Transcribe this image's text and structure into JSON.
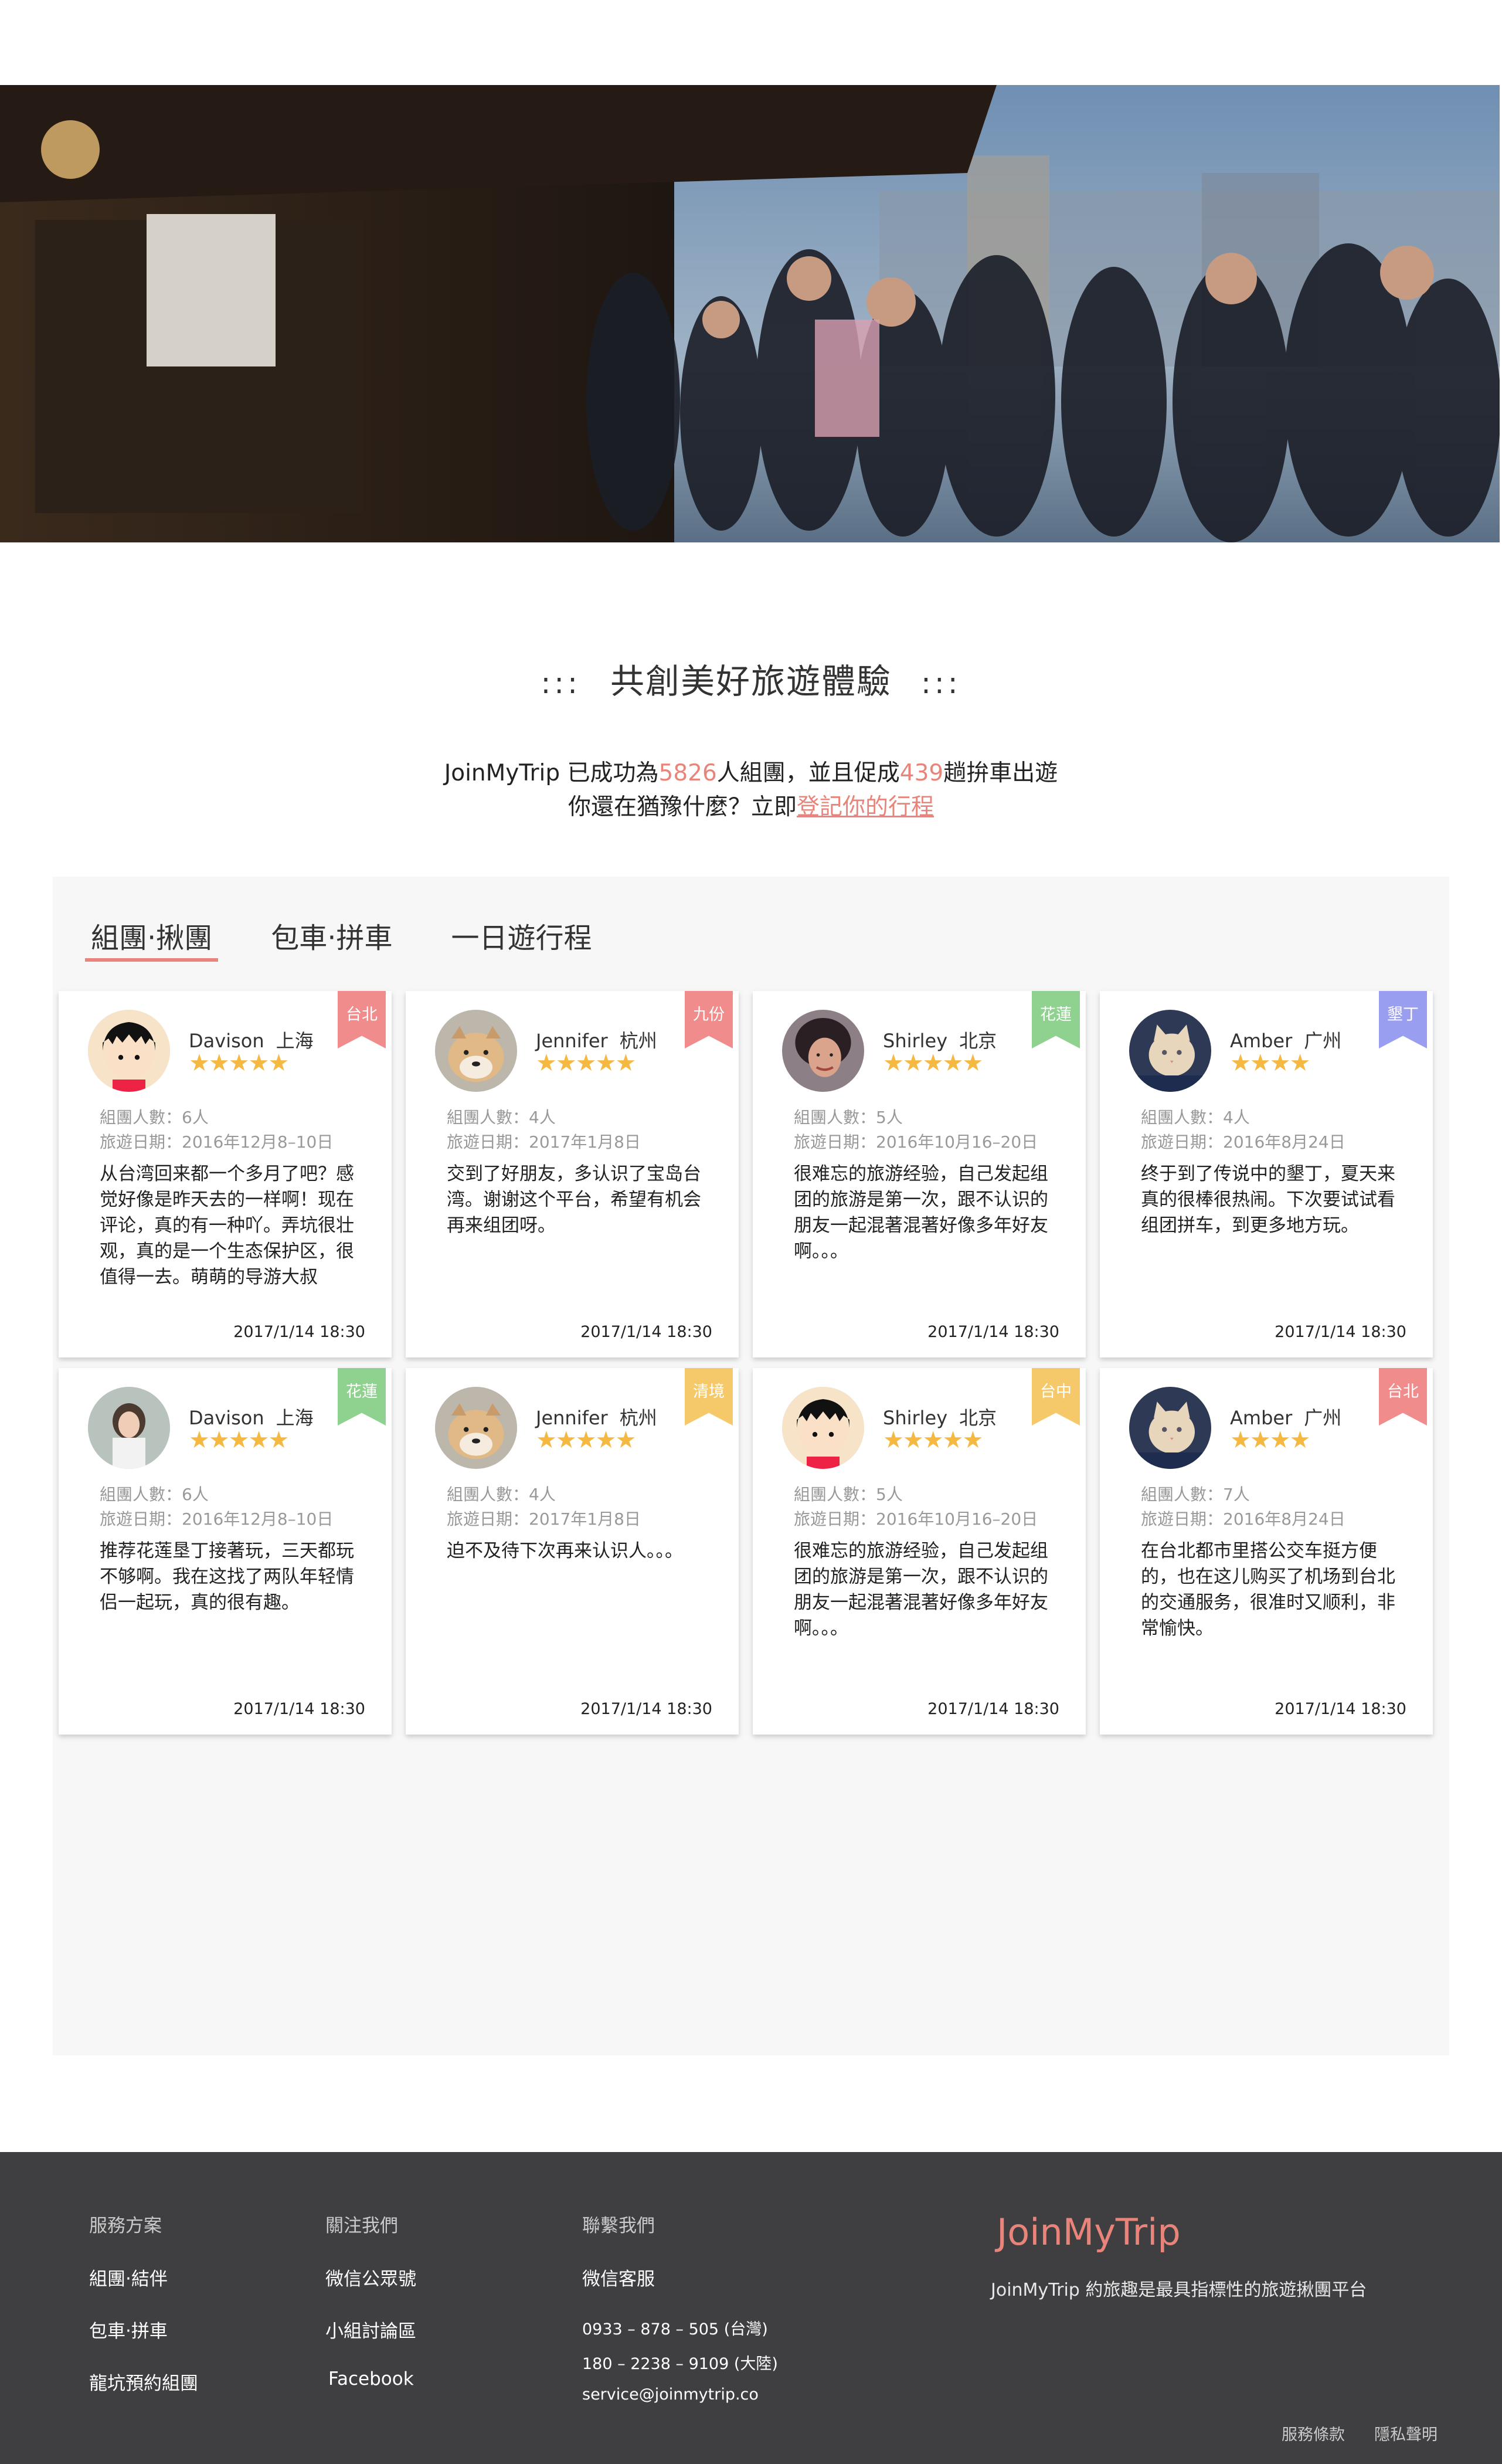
{
  "intro": {
    "title": "共創美好旅遊體驗",
    "dots_left": ":::",
    "dots_right": ":::",
    "line1_pre": "JoinMyTrip 已成功為",
    "groups_count": "5826",
    "line1_mid": "人組團，並且促成",
    "carpool_count": "439",
    "line1_post": "趟拚車出遊",
    "line2_pre": "你還在猶豫什麼？立即",
    "line2_link": "登記你的行程"
  },
  "tabs": [
    "組團‧揪團",
    "包車‧拼車",
    "一日遊行程"
  ],
  "cards": [
    {
      "name": "Davison",
      "city": "上海",
      "stars": 5,
      "tag": "台北",
      "tag_color": "#f08c8c",
      "members": "組團人數：6人",
      "dates": "旅遊日期：2016年12月8–10日",
      "text": "从台湾回来都一个多月了吧？感觉好像是昨天去的一样啊！现在评论，真的有一种吖。弄坑很壮观，真的是一个生态保护区，很值得一去。萌萌的导游大叔",
      "time": "2017/1/14  18:30",
      "avatar": "cartoon-girl-avatar"
    },
    {
      "name": "Jennifer",
      "city": "杭州",
      "stars": 5,
      "tag": "九份",
      "tag_color": "#f08c8c",
      "members": "組團人數：4人",
      "dates": "旅遊日期：2017年1月8日",
      "text": "交到了好朋友，多认识了宝岛台湾。谢谢这个平台，希望有机会再来组团呀。",
      "time": "2017/1/14  18:30",
      "avatar": "dog-avatar"
    },
    {
      "name": "Shirley",
      "city": "北京",
      "stars": 5,
      "tag": "花蓮",
      "tag_color": "#8fd18f",
      "members": "組團人數：5人",
      "dates": "旅遊日期：2016年10月16–20日",
      "text": "很难忘的旅游经验，自己发起组团的旅游是第一次，跟不认识的朋友一起混著混著好像多年好友啊。。。",
      "time": "2017/1/14  18:30",
      "avatar": "woman-avatar"
    },
    {
      "name": "Amber",
      "city": "广州",
      "stars": 4,
      "tag": "墾丁",
      "tag_color": "#9a9ef0",
      "members": "組團人數：4人",
      "dates": "旅遊日期：2016年8月24日",
      "text": "终于到了传说中的墾丁，夏天来真的很棒很热闹。下次要试试看组团拼车，到更多地方玩。",
      "time": "2017/1/14  18:30",
      "avatar": "cat-avatar"
    },
    {
      "name": "Davison",
      "city": "上海",
      "stars": 5,
      "tag": "花蓮",
      "tag_color": "#8fd18f",
      "members": "組團人數：6人",
      "dates": "旅遊日期：2016年12月8–10日",
      "text": "推荐花莲垦丁接著玩，三天都玩不够啊。我在这找了两队年轻情侣一起玩，真的很有趣。",
      "time": "2017/1/14  18:30",
      "avatar": "girl-photo-avatar"
    },
    {
      "name": "Jennifer",
      "city": "杭州",
      "stars": 5,
      "tag": "清境",
      "tag_color": "#f5c96a",
      "members": "組團人數：4人",
      "dates": "旅遊日期：2017年1月8日",
      "text": "迫不及待下次再来认识人。。。",
      "time": "2017/1/14  18:30",
      "avatar": "dog-avatar"
    },
    {
      "name": "Shirley",
      "city": "北京",
      "stars": 5,
      "tag": "台中",
      "tag_color": "#f5c96a",
      "members": "組團人數：5人",
      "dates": "旅遊日期：2016年10月16–20日",
      "text": "很难忘的旅游经验，自己发起组团的旅游是第一次，跟不认识的朋友一起混著混著好像多年好友啊。。。",
      "time": "2017/1/14  18:30",
      "avatar": "cartoon-girl-avatar"
    },
    {
      "name": "Amber",
      "city": "广州",
      "stars": 4,
      "tag": "台北",
      "tag_color": "#f08c8c",
      "members": "組團人數：7人",
      "dates": "旅遊日期：2016年8月24日",
      "text": "在台北都市里搭公交车挺方便的，也在这儿购买了机场到台北的交通服务，很准时又顺利，非常愉快。",
      "time": "2017/1/14  18:30",
      "avatar": "cat-avatar"
    }
  ],
  "footer": {
    "col1_head": "服務方案",
    "col1_links": [
      "組團‧結伴",
      "包車‧拼車",
      "龍坑預約組團"
    ],
    "col2_head": "關注我們",
    "col2_links": [
      "微信公眾號",
      "小組討論區",
      "Facebook"
    ],
    "col3_head": "聯繫我們",
    "col3_sub": "微信客服",
    "phone_tw": "0933 – 878 – 505 (台灣)",
    "phone_cn": "180 – 2238 – 9109 (大陸)",
    "email": "service@joinmytrip.co",
    "brand": "JoinMyTrip",
    "tagline": "JoinMyTrip 約旅趣是最具指標性的旅遊揪團平台",
    "terms": "服務條款",
    "privacy": "隱私聲明"
  }
}
